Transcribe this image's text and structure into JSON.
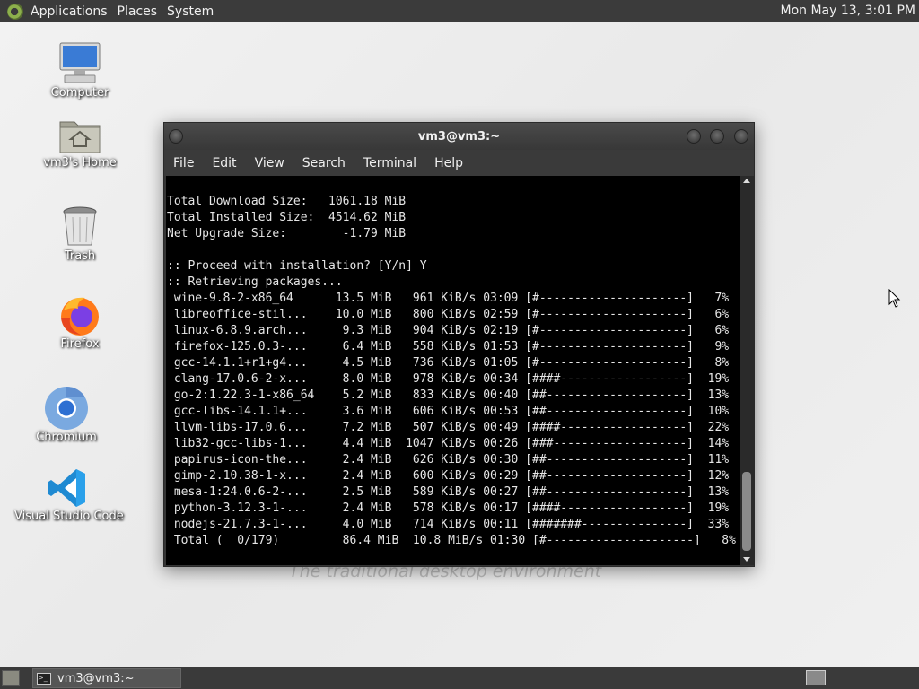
{
  "top_panel": {
    "menus": [
      "Applications",
      "Places",
      "System"
    ],
    "clock": "Mon May 13,  3:01 PM"
  },
  "desktop_icons": [
    {
      "label": "Computer",
      "icon": "computer-icon"
    },
    {
      "label": "vm3's Home",
      "icon": "home-folder-icon"
    },
    {
      "label": "Trash",
      "icon": "trash-icon"
    },
    {
      "label": "Firefox",
      "icon": "firefox-icon"
    },
    {
      "label": "Chromium",
      "icon": "chromium-icon"
    },
    {
      "label": "Visual Studio Code",
      "icon": "vscode-icon"
    }
  ],
  "watermark": "The traditional desktop environment",
  "terminal": {
    "title": "vm3@vm3:~",
    "menu": [
      "File",
      "Edit",
      "View",
      "Search",
      "Terminal",
      "Help"
    ],
    "lines": [
      "Total Download Size:   1061.18 MiB",
      "Total Installed Size:  4514.62 MiB",
      "Net Upgrade Size:        -1.79 MiB",
      "",
      ":: Proceed with installation? [Y/n] Y",
      ":: Retrieving packages...",
      " wine-9.8-2-x86_64      13.5 MiB   961 KiB/s 03:09 [#---------------------]   7%",
      " libreoffice-stil...    10.0 MiB   800 KiB/s 02:59 [#---------------------]   6%",
      " linux-6.8.9.arch...     9.3 MiB   904 KiB/s 02:19 [#---------------------]   6%",
      " firefox-125.0.3-...     6.4 MiB   558 KiB/s 01:53 [#---------------------]   9%",
      " gcc-14.1.1+r1+g4...     4.5 MiB   736 KiB/s 01:05 [#---------------------]   8%",
      " clang-17.0.6-2-x...     8.0 MiB   978 KiB/s 00:34 [####------------------]  19%",
      " go-2:1.22.3-1-x86_64    5.2 MiB   833 KiB/s 00:40 [##--------------------]  13%",
      " gcc-libs-14.1.1+...     3.6 MiB   606 KiB/s 00:53 [##--------------------]  10%",
      " llvm-libs-17.0.6...     7.2 MiB   507 KiB/s 00:49 [####------------------]  22%",
      " lib32-gcc-libs-1...     4.4 MiB  1047 KiB/s 00:26 [###-------------------]  14%",
      " papirus-icon-the...     2.4 MiB   626 KiB/s 00:30 [##--------------------]  11%",
      " gimp-2.10.38-1-x...     2.4 MiB   600 KiB/s 00:29 [##--------------------]  12%",
      " mesa-1:24.0.6-2-...     2.5 MiB   589 KiB/s 00:27 [##--------------------]  13%",
      " python-3.12.3-1-...     2.4 MiB   578 KiB/s 00:17 [####------------------]  19%",
      " nodejs-21.7.3-1-...     4.0 MiB   714 KiB/s 00:11 [#######---------------]  33%",
      " Total (  0/179)         86.4 MiB  10.8 MiB/s 01:30 [#---------------------]   8%"
    ]
  },
  "taskbar": {
    "task_label": "vm3@vm3:~"
  }
}
